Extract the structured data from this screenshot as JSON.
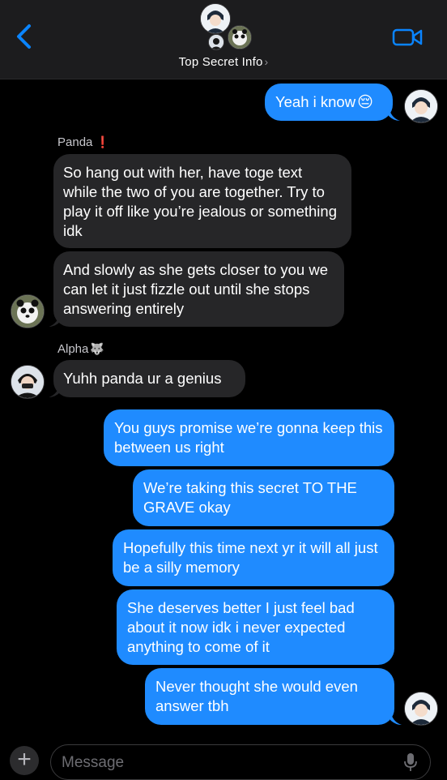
{
  "header": {
    "title": "Top Secret Info",
    "chevron": "›",
    "back_icon": "chevron-left-icon",
    "video_icon": "video-camera-icon"
  },
  "messages": [
    {
      "id": "m1",
      "direction": "outgoing",
      "text": "Yeah i know",
      "emoji": "😔"
    },
    {
      "id": "m2",
      "direction": "incoming",
      "sender": "Panda",
      "sender_emoji": "❗",
      "text": "So hang out with her, have toge text while the two of you are together. Try to play it off like you’re jealous or something idk"
    },
    {
      "id": "m3",
      "direction": "incoming",
      "text": "And slowly as she gets closer to you we can let it just fizzle out until she stops answering entirely"
    },
    {
      "id": "m4",
      "direction": "incoming",
      "sender": "Alpha",
      "sender_emoji": "🐺",
      "text": "Yuhh panda ur a genius"
    },
    {
      "id": "m5",
      "direction": "outgoing",
      "text": "You guys promise we’re gonna keep this between us right"
    },
    {
      "id": "m6",
      "direction": "outgoing",
      "text": "We’re taking this secret TO THE GRAVE okay"
    },
    {
      "id": "m7",
      "direction": "outgoing",
      "text": "Hopefully this time next yr it will all just be a silly memory"
    },
    {
      "id": "m8",
      "direction": "outgoing",
      "text": "She deserves better I just feel bad about it now idk i never expected anything to come of it"
    },
    {
      "id": "m9",
      "direction": "outgoing",
      "text": "Never thought she would even answer tbh"
    }
  ],
  "composer": {
    "placeholder": "Message",
    "plus": "+",
    "mic_icon": "microphone-icon"
  },
  "colors": {
    "outgoing_bubble": "#1f8bff",
    "incoming_bubble": "#262628",
    "header_bg": "#1c1c1e",
    "accent": "#0a84ff"
  }
}
